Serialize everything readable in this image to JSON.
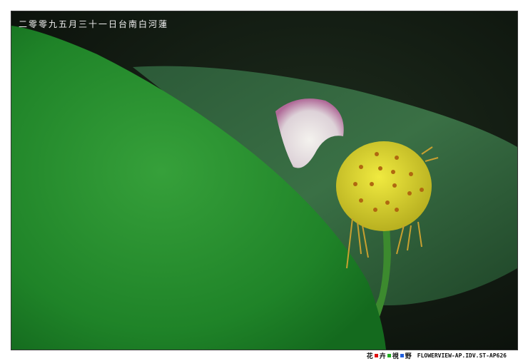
{
  "photo": {
    "caption": "二零零九五月三十一日台南白河蓮"
  },
  "footer": {
    "brand_chars": [
      "花",
      "卉",
      "視",
      "野"
    ],
    "brand_square_colors": [
      "#e01010",
      "#20b020",
      "#2060e0"
    ],
    "site": "FLOWERVIEW-AP.IDV.ST-AP626"
  }
}
